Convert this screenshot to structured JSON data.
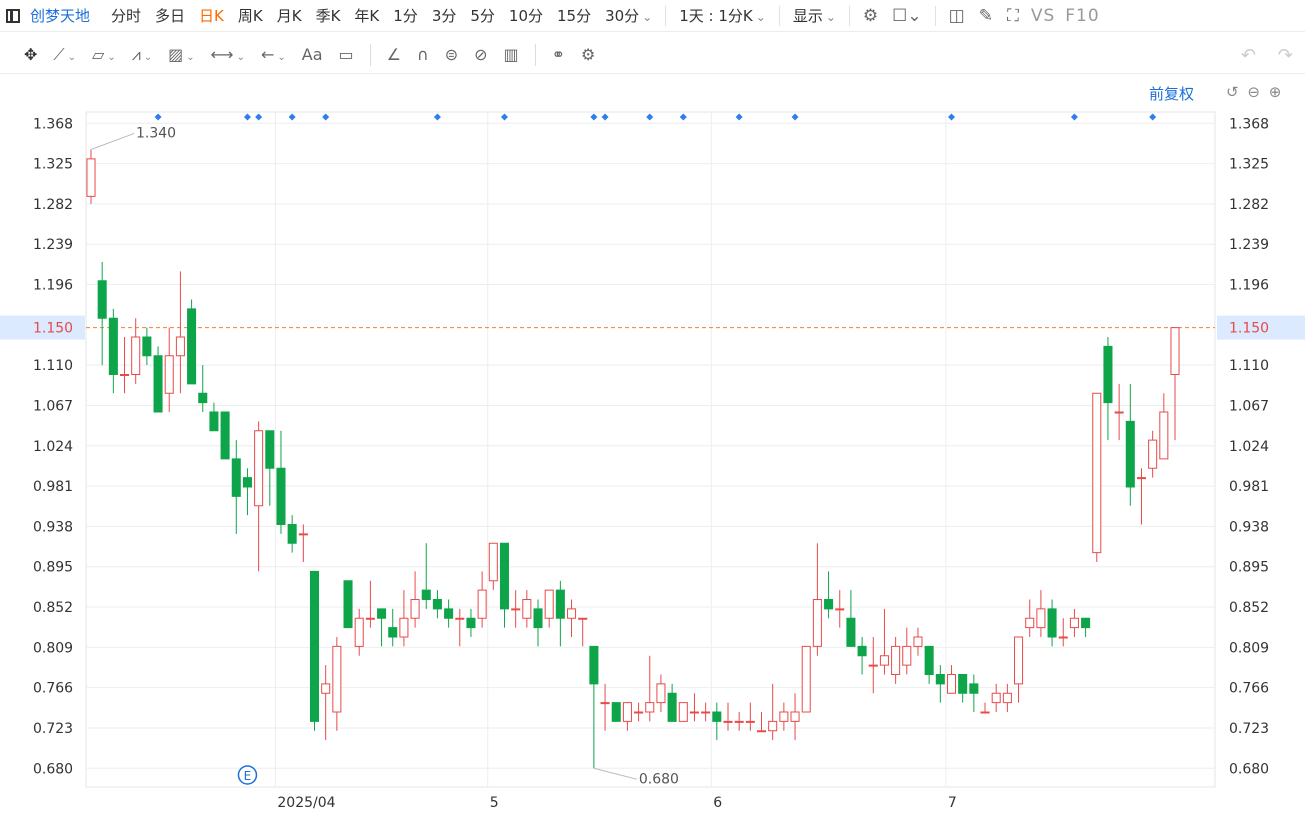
{
  "header": {
    "stock_name": "创梦天地",
    "periods": [
      "分时",
      "多日",
      "日K",
      "周K",
      "月K",
      "季K",
      "年K",
      "1分",
      "3分",
      "5分",
      "10分",
      "15分",
      "30分"
    ],
    "active_period": "日K",
    "interval_select": "1天 : 1分K",
    "display_select": "显示",
    "vs_label": "VS",
    "f10_label": "F10"
  },
  "toolbar": {
    "font_label": "Aa",
    "adjust_label": "前复权"
  },
  "colors": {
    "up": "#e84a4a",
    "down": "#0ea54a",
    "accent": "#1e6fd9",
    "active_period": "#ff6a00",
    "current_price_line": "#f08030",
    "marker": "#2e7ef0"
  },
  "chart_data": {
    "type": "candlestick",
    "title": "",
    "yticks": [
      "1.368",
      "1.325",
      "1.282",
      "1.239",
      "1.196",
      "1.150",
      "1.110",
      "1.067",
      "1.024",
      "0.981",
      "0.938",
      "0.895",
      "0.852",
      "0.809",
      "0.766",
      "0.723",
      "0.680"
    ],
    "ylim": [
      0.66,
      1.38
    ],
    "current_price": "1.150",
    "xticks": [
      {
        "index": 17,
        "label": "2025/04"
      },
      {
        "index": 36,
        "label": "5"
      },
      {
        "index": 56,
        "label": "6"
      },
      {
        "index": 77,
        "label": "7"
      }
    ],
    "annotations": [
      {
        "label": "1.340",
        "index": 0,
        "price": 1.34,
        "kind": "high"
      },
      {
        "label": "0.680",
        "index": 45,
        "price": 0.68,
        "kind": "low"
      }
    ],
    "event_marker": "E",
    "event_marker_index": 14,
    "dot_markers": [
      6,
      14,
      15,
      18,
      21,
      31,
      37,
      45,
      46,
      50,
      53,
      58,
      63,
      77,
      88,
      95
    ],
    "candles": [
      {
        "o": 1.29,
        "h": 1.34,
        "l": 1.282,
        "c": 1.33
      },
      {
        "o": 1.2,
        "h": 1.22,
        "l": 1.11,
        "c": 1.16
      },
      {
        "o": 1.16,
        "h": 1.17,
        "l": 1.08,
        "c": 1.1
      },
      {
        "o": 1.1,
        "h": 1.14,
        "l": 1.08,
        "c": 1.1
      },
      {
        "o": 1.1,
        "h": 1.16,
        "l": 1.09,
        "c": 1.14
      },
      {
        "o": 1.14,
        "h": 1.15,
        "l": 1.11,
        "c": 1.12
      },
      {
        "o": 1.12,
        "h": 1.13,
        "l": 1.06,
        "c": 1.06
      },
      {
        "o": 1.08,
        "h": 1.15,
        "l": 1.06,
        "c": 1.12
      },
      {
        "o": 1.12,
        "h": 1.21,
        "l": 1.08,
        "c": 1.14
      },
      {
        "o": 1.17,
        "h": 1.18,
        "l": 1.09,
        "c": 1.09
      },
      {
        "o": 1.08,
        "h": 1.11,
        "l": 1.06,
        "c": 1.07
      },
      {
        "o": 1.06,
        "h": 1.07,
        "l": 1.04,
        "c": 1.04
      },
      {
        "o": 1.06,
        "h": 1.06,
        "l": 1.01,
        "c": 1.01
      },
      {
        "o": 1.01,
        "h": 1.03,
        "l": 0.93,
        "c": 0.97
      },
      {
        "o": 0.99,
        "h": 1.0,
        "l": 0.95,
        "c": 0.98
      },
      {
        "o": 0.96,
        "h": 1.05,
        "l": 0.89,
        "c": 1.04
      },
      {
        "o": 1.04,
        "h": 1.04,
        "l": 0.96,
        "c": 1.0
      },
      {
        "o": 1.0,
        "h": 1.04,
        "l": 0.93,
        "c": 0.94
      },
      {
        "o": 0.94,
        "h": 0.95,
        "l": 0.91,
        "c": 0.92
      },
      {
        "o": 0.93,
        "h": 0.94,
        "l": 0.9,
        "c": 0.93
      },
      {
        "o": 0.89,
        "h": 0.89,
        "l": 0.72,
        "c": 0.73
      },
      {
        "o": 0.76,
        "h": 0.79,
        "l": 0.71,
        "c": 0.77
      },
      {
        "o": 0.74,
        "h": 0.82,
        "l": 0.72,
        "c": 0.81
      },
      {
        "o": 0.88,
        "h": 0.88,
        "l": 0.83,
        "c": 0.83
      },
      {
        "o": 0.81,
        "h": 0.85,
        "l": 0.8,
        "c": 0.84
      },
      {
        "o": 0.84,
        "h": 0.88,
        "l": 0.83,
        "c": 0.84
      },
      {
        "o": 0.85,
        "h": 0.85,
        "l": 0.81,
        "c": 0.84
      },
      {
        "o": 0.83,
        "h": 0.85,
        "l": 0.81,
        "c": 0.82
      },
      {
        "o": 0.82,
        "h": 0.87,
        "l": 0.81,
        "c": 0.84
      },
      {
        "o": 0.84,
        "h": 0.89,
        "l": 0.83,
        "c": 0.86
      },
      {
        "o": 0.87,
        "h": 0.92,
        "l": 0.85,
        "c": 0.86
      },
      {
        "o": 0.86,
        "h": 0.87,
        "l": 0.84,
        "c": 0.85
      },
      {
        "o": 0.85,
        "h": 0.86,
        "l": 0.83,
        "c": 0.84
      },
      {
        "o": 0.84,
        "h": 0.85,
        "l": 0.81,
        "c": 0.84
      },
      {
        "o": 0.84,
        "h": 0.85,
        "l": 0.82,
        "c": 0.83
      },
      {
        "o": 0.84,
        "h": 0.89,
        "l": 0.83,
        "c": 0.87
      },
      {
        "o": 0.88,
        "h": 0.92,
        "l": 0.87,
        "c": 0.92
      },
      {
        "o": 0.92,
        "h": 0.92,
        "l": 0.83,
        "c": 0.85
      },
      {
        "o": 0.85,
        "h": 0.87,
        "l": 0.83,
        "c": 0.85
      },
      {
        "o": 0.84,
        "h": 0.87,
        "l": 0.83,
        "c": 0.86
      },
      {
        "o": 0.85,
        "h": 0.86,
        "l": 0.81,
        "c": 0.83
      },
      {
        "o": 0.84,
        "h": 0.87,
        "l": 0.83,
        "c": 0.87
      },
      {
        "o": 0.87,
        "h": 0.88,
        "l": 0.81,
        "c": 0.84
      },
      {
        "o": 0.84,
        "h": 0.86,
        "l": 0.82,
        "c": 0.85
      },
      {
        "o": 0.84,
        "h": 0.84,
        "l": 0.81,
        "c": 0.84
      },
      {
        "o": 0.81,
        "h": 0.81,
        "l": 0.68,
        "c": 0.77
      },
      {
        "o": 0.75,
        "h": 0.77,
        "l": 0.72,
        "c": 0.75
      },
      {
        "o": 0.75,
        "h": 0.75,
        "l": 0.73,
        "c": 0.73
      },
      {
        "o": 0.73,
        "h": 0.75,
        "l": 0.72,
        "c": 0.75
      },
      {
        "o": 0.74,
        "h": 0.75,
        "l": 0.73,
        "c": 0.74
      },
      {
        "o": 0.74,
        "h": 0.8,
        "l": 0.73,
        "c": 0.75
      },
      {
        "o": 0.75,
        "h": 0.78,
        "l": 0.74,
        "c": 0.77
      },
      {
        "o": 0.76,
        "h": 0.77,
        "l": 0.73,
        "c": 0.73
      },
      {
        "o": 0.73,
        "h": 0.75,
        "l": 0.73,
        "c": 0.75
      },
      {
        "o": 0.74,
        "h": 0.76,
        "l": 0.73,
        "c": 0.74
      },
      {
        "o": 0.74,
        "h": 0.75,
        "l": 0.73,
        "c": 0.74
      },
      {
        "o": 0.74,
        "h": 0.75,
        "l": 0.71,
        "c": 0.73
      },
      {
        "o": 0.73,
        "h": 0.75,
        "l": 0.72,
        "c": 0.73
      },
      {
        "o": 0.73,
        "h": 0.74,
        "l": 0.72,
        "c": 0.73
      },
      {
        "o": 0.73,
        "h": 0.75,
        "l": 0.72,
        "c": 0.73
      },
      {
        "o": 0.72,
        "h": 0.74,
        "l": 0.72,
        "c": 0.72
      },
      {
        "o": 0.72,
        "h": 0.77,
        "l": 0.71,
        "c": 0.73
      },
      {
        "o": 0.73,
        "h": 0.75,
        "l": 0.72,
        "c": 0.74
      },
      {
        "o": 0.73,
        "h": 0.76,
        "l": 0.71,
        "c": 0.74
      },
      {
        "o": 0.74,
        "h": 0.81,
        "l": 0.74,
        "c": 0.81
      },
      {
        "o": 0.81,
        "h": 0.92,
        "l": 0.8,
        "c": 0.86
      },
      {
        "o": 0.86,
        "h": 0.89,
        "l": 0.84,
        "c": 0.85
      },
      {
        "o": 0.85,
        "h": 0.87,
        "l": 0.83,
        "c": 0.85
      },
      {
        "o": 0.84,
        "h": 0.87,
        "l": 0.81,
        "c": 0.81
      },
      {
        "o": 0.81,
        "h": 0.82,
        "l": 0.78,
        "c": 0.8
      },
      {
        "o": 0.79,
        "h": 0.82,
        "l": 0.76,
        "c": 0.79
      },
      {
        "o": 0.79,
        "h": 0.85,
        "l": 0.78,
        "c": 0.8
      },
      {
        "o": 0.78,
        "h": 0.82,
        "l": 0.77,
        "c": 0.81
      },
      {
        "o": 0.79,
        "h": 0.83,
        "l": 0.78,
        "c": 0.81
      },
      {
        "o": 0.81,
        "h": 0.83,
        "l": 0.8,
        "c": 0.82
      },
      {
        "o": 0.81,
        "h": 0.81,
        "l": 0.77,
        "c": 0.78
      },
      {
        "o": 0.78,
        "h": 0.79,
        "l": 0.75,
        "c": 0.77
      },
      {
        "o": 0.76,
        "h": 0.79,
        "l": 0.76,
        "c": 0.78
      },
      {
        "o": 0.78,
        "h": 0.78,
        "l": 0.75,
        "c": 0.76
      },
      {
        "o": 0.77,
        "h": 0.78,
        "l": 0.74,
        "c": 0.76
      },
      {
        "o": 0.74,
        "h": 0.75,
        "l": 0.74,
        "c": 0.74
      },
      {
        "o": 0.75,
        "h": 0.77,
        "l": 0.74,
        "c": 0.76
      },
      {
        "o": 0.75,
        "h": 0.77,
        "l": 0.74,
        "c": 0.76
      },
      {
        "o": 0.77,
        "h": 0.82,
        "l": 0.75,
        "c": 0.82
      },
      {
        "o": 0.83,
        "h": 0.86,
        "l": 0.82,
        "c": 0.84
      },
      {
        "o": 0.83,
        "h": 0.87,
        "l": 0.82,
        "c": 0.85
      },
      {
        "o": 0.85,
        "h": 0.86,
        "l": 0.81,
        "c": 0.82
      },
      {
        "o": 0.82,
        "h": 0.84,
        "l": 0.81,
        "c": 0.82
      },
      {
        "o": 0.83,
        "h": 0.85,
        "l": 0.82,
        "c": 0.84
      },
      {
        "o": 0.84,
        "h": 0.84,
        "l": 0.82,
        "c": 0.83
      },
      {
        "o": 0.91,
        "h": 1.08,
        "l": 0.9,
        "c": 1.08
      },
      {
        "o": 1.13,
        "h": 1.14,
        "l": 1.03,
        "c": 1.07
      },
      {
        "o": 1.06,
        "h": 1.09,
        "l": 1.03,
        "c": 1.06
      },
      {
        "o": 1.05,
        "h": 1.09,
        "l": 0.96,
        "c": 0.98
      },
      {
        "o": 0.99,
        "h": 1.0,
        "l": 0.94,
        "c": 0.99
      },
      {
        "o": 1.0,
        "h": 1.04,
        "l": 0.99,
        "c": 1.03
      },
      {
        "o": 1.01,
        "h": 1.08,
        "l": 1.01,
        "c": 1.06
      },
      {
        "o": 1.1,
        "h": 1.15,
        "l": 1.03,
        "c": 1.15
      }
    ]
  }
}
